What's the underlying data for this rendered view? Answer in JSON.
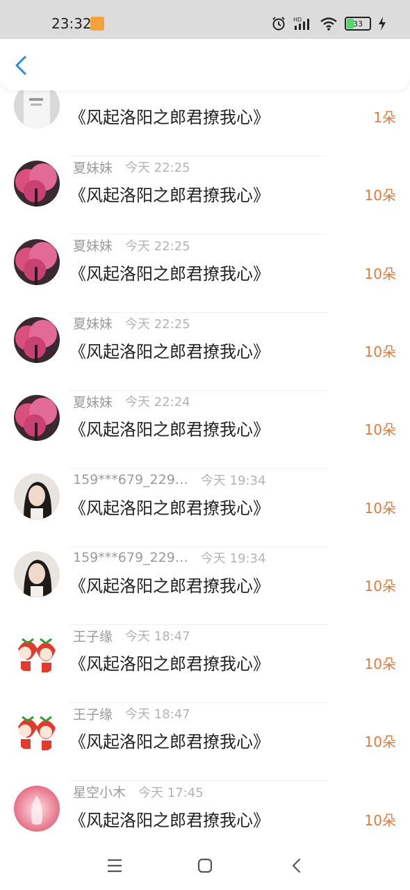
{
  "status_bar": {
    "time": "23:32",
    "battery": "33",
    "battery_level": 0.33,
    "icons": [
      "app-notification-icon",
      "alarm-icon",
      "hd-signal-icon",
      "wifi-icon",
      "battery-icon",
      "charging-icon"
    ]
  },
  "header": {
    "back_icon": "chevron-left-icon",
    "accent": "#2b8ce6"
  },
  "colors": {
    "gift_count": "#e07b3c",
    "name": "#9a9a9a",
    "message": "#222222"
  },
  "rows": [
    {
      "name": "",
      "time": "",
      "message": "《风起洛阳之郎君撩我心》",
      "count": "1朵",
      "avatar": "white-shirt-photo"
    },
    {
      "name": "夏妹妹",
      "time": "今天 22:25",
      "message": "《风起洛阳之郎君撩我心》",
      "count": "10朵",
      "avatar": "pink-blossom-tree"
    },
    {
      "name": "夏妹妹",
      "time": "今天 22:25",
      "message": "《风起洛阳之郎君撩我心》",
      "count": "10朵",
      "avatar": "pink-blossom-tree"
    },
    {
      "name": "夏妹妹",
      "time": "今天 22:25",
      "message": "《风起洛阳之郎君撩我心》",
      "count": "10朵",
      "avatar": "pink-blossom-tree"
    },
    {
      "name": "夏妹妹",
      "time": "今天 22:24",
      "message": "《风起洛阳之郎君撩我心》",
      "count": "10朵",
      "avatar": "pink-blossom-tree"
    },
    {
      "name": "159***679_229…",
      "time": "今天 19:34",
      "message": "《风起洛阳之郎君撩我心》",
      "count": "10朵",
      "avatar": "girl-portrait"
    },
    {
      "name": "159***679_229…",
      "time": "今天 19:34",
      "message": "《风起洛阳之郎君撩我心》",
      "count": "10朵",
      "avatar": "girl-portrait"
    },
    {
      "name": "王子缘",
      "time": "今天 18:47",
      "message": "《风起洛阳之郎君撩我心》",
      "count": "10朵",
      "avatar": "strawberry-cartoon"
    },
    {
      "name": "王子缘",
      "time": "今天 18:47",
      "message": "《风起洛阳之郎君撩我心》",
      "count": "10朵",
      "avatar": "strawberry-cartoon"
    },
    {
      "name": "星空小木",
      "time": "今天 17:45",
      "message": "《风起洛阳之郎君撩我心》",
      "count": "10朵",
      "avatar": "pink-glow-figure"
    }
  ],
  "nav_bar": {
    "icons": [
      "menu-icon",
      "home-icon",
      "back-icon"
    ]
  }
}
